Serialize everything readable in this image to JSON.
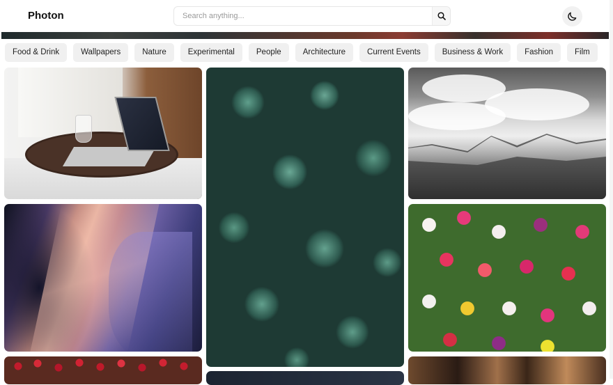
{
  "header": {
    "brand": "Photon",
    "search_placeholder": "Search anything...",
    "search_icon": "search-icon",
    "theme_icon": "moon-icon"
  },
  "categories": [
    "Food & Drink",
    "Wallpapers",
    "Nature",
    "Experimental",
    "People",
    "Architecture",
    "Current Events",
    "Business & Work",
    "Fashion",
    "Film"
  ],
  "colors": {
    "chip_bg": "#f0f0f0",
    "text": "#111111"
  }
}
